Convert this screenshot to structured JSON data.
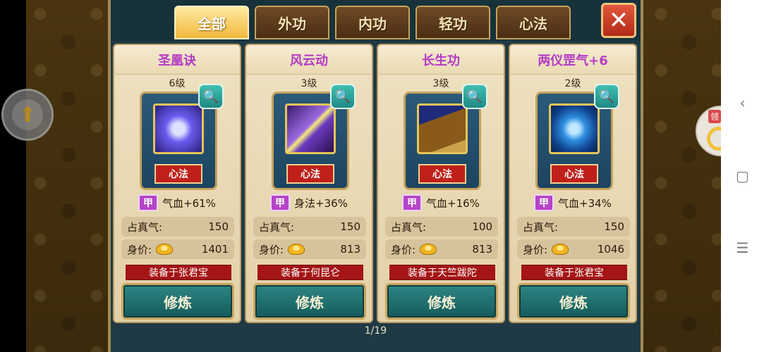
{
  "tabs": [
    {
      "label": "全部",
      "active": true
    },
    {
      "label": "外功",
      "active": false
    },
    {
      "label": "内功",
      "active": false
    },
    {
      "label": "轻功",
      "active": false
    },
    {
      "label": "心法",
      "active": false
    }
  ],
  "close_icon": "close-x",
  "cards": [
    {
      "name": "圣凰诀",
      "level": "6级",
      "type": "心法",
      "grade": "甲",
      "stat": "气血+61%",
      "zhenqi_label": "占真气:",
      "zhenqi": "150",
      "price_label": "身价:",
      "price": "1401",
      "equipped": "装备于张君宝",
      "train": "修炼",
      "icon_color": "#5a4fd8"
    },
    {
      "name": "风云动",
      "level": "3级",
      "type": "心法",
      "grade": "甲",
      "stat": "身法+36%",
      "zhenqi_label": "占真气:",
      "zhenqi": "150",
      "price_label": "身价:",
      "price": "813",
      "equipped": "装备于何昆仑",
      "train": "修炼",
      "icon_color": "#7a3ab8"
    },
    {
      "name": "长生功",
      "level": "3级",
      "type": "心法",
      "grade": "甲",
      "stat": "气血+16%",
      "zhenqi_label": "占真气:",
      "zhenqi": "100",
      "price_label": "身价:",
      "price": "813",
      "equipped": "装备于天竺跋陀",
      "train": "修炼",
      "icon_color": "#2a3ea8"
    },
    {
      "name": "两仪罡气+6",
      "level": "2级",
      "type": "心法",
      "grade": "甲",
      "stat": "气血+34%",
      "zhenqi_label": "占真气:",
      "zhenqi": "150",
      "price_label": "身价:",
      "price": "1046",
      "equipped": "装备于张君宝",
      "train": "修炼",
      "icon_color": "#1f6fc4"
    }
  ],
  "page": "1/19",
  "side_tag": "领"
}
